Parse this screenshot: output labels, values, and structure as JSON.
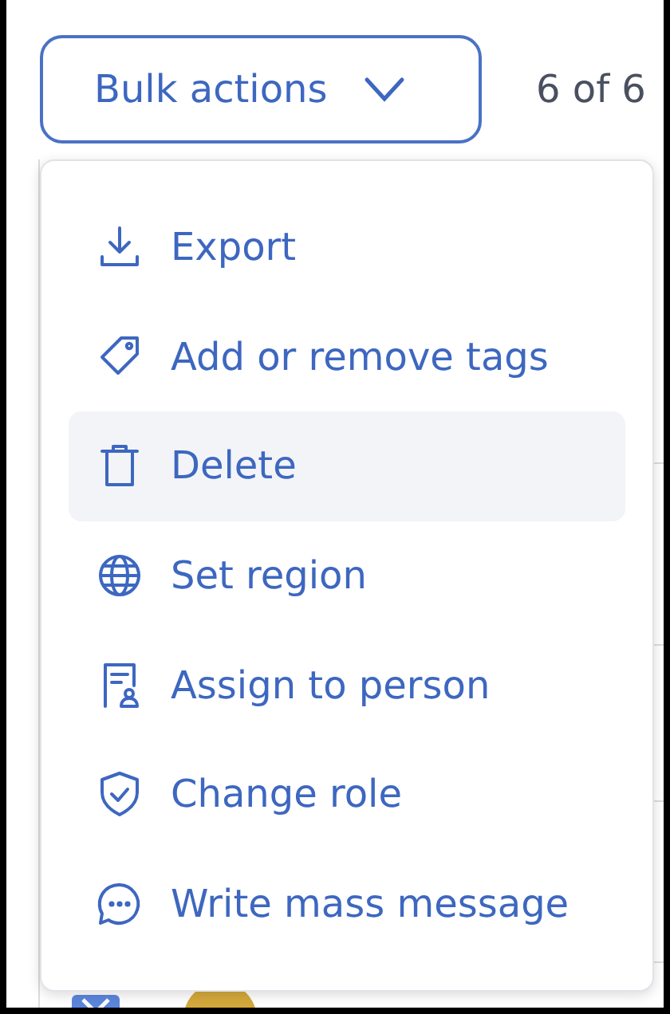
{
  "toolbar": {
    "bulk_button": {
      "label": "Bulk actions",
      "expanded": true
    },
    "count": "6 of 6"
  },
  "menu": {
    "items": [
      {
        "label": "Export",
        "selected": false
      },
      {
        "label": "Add or remove tags",
        "selected": false
      },
      {
        "label": "Delete",
        "selected": true
      },
      {
        "label": "Set region",
        "selected": false
      },
      {
        "label": "Assign to person",
        "selected": false
      },
      {
        "label": "Change role",
        "selected": false
      },
      {
        "label": "Write mass message",
        "selected": false
      }
    ]
  },
  "table": {
    "rows": [
      {
        "checked": true
      }
    ]
  }
}
